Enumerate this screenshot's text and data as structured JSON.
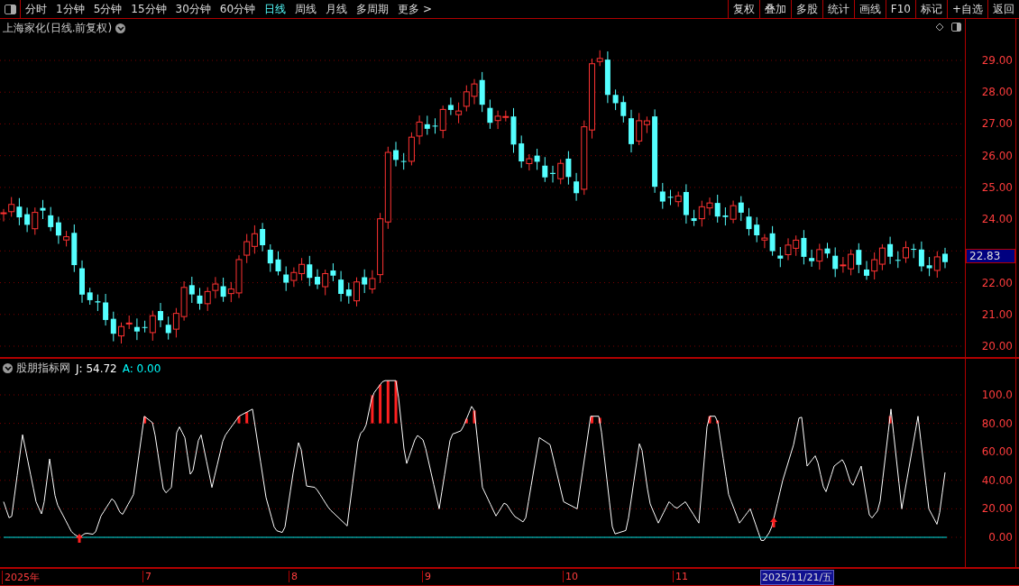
{
  "toolbar": {
    "periods": [
      {
        "label": "分时",
        "selected": false
      },
      {
        "label": "1分钟",
        "selected": false
      },
      {
        "label": "5分钟",
        "selected": false
      },
      {
        "label": "15分钟",
        "selected": false
      },
      {
        "label": "30分钟",
        "selected": false
      },
      {
        "label": "60分钟",
        "selected": false
      },
      {
        "label": "日线",
        "selected": true
      },
      {
        "label": "周线",
        "selected": false
      },
      {
        "label": "月线",
        "selected": false
      },
      {
        "label": "多周期",
        "selected": false
      },
      {
        "label": "更多 >",
        "selected": false
      }
    ],
    "actions": [
      "复权",
      "叠加",
      "多股",
      "统计",
      "画线",
      "F10",
      "标记",
      "+自选",
      "返回"
    ]
  },
  "main_chart": {
    "title": "上海家化(日线.前复权)",
    "price_ticks": [
      "29.00",
      "28.00",
      "27.00",
      "26.00",
      "25.00",
      "24.00",
      "22.00",
      "21.00",
      "20.00"
    ],
    "last_price": "22.83"
  },
  "indicator": {
    "name": "股朋指标网",
    "readouts": [
      {
        "label": "J: 54.72",
        "color": "#ffffff"
      },
      {
        "label": "A: 0.00",
        "color": "#00ffff"
      }
    ],
    "ticks": [
      "100.0",
      "80.00",
      "60.00",
      "40.00",
      "20.00",
      "0.00"
    ]
  },
  "time_axis": {
    "labels": [
      "2025年",
      "7",
      "8",
      "9",
      "10",
      "11"
    ],
    "cursor_date": "2025/11/21/五"
  }
}
